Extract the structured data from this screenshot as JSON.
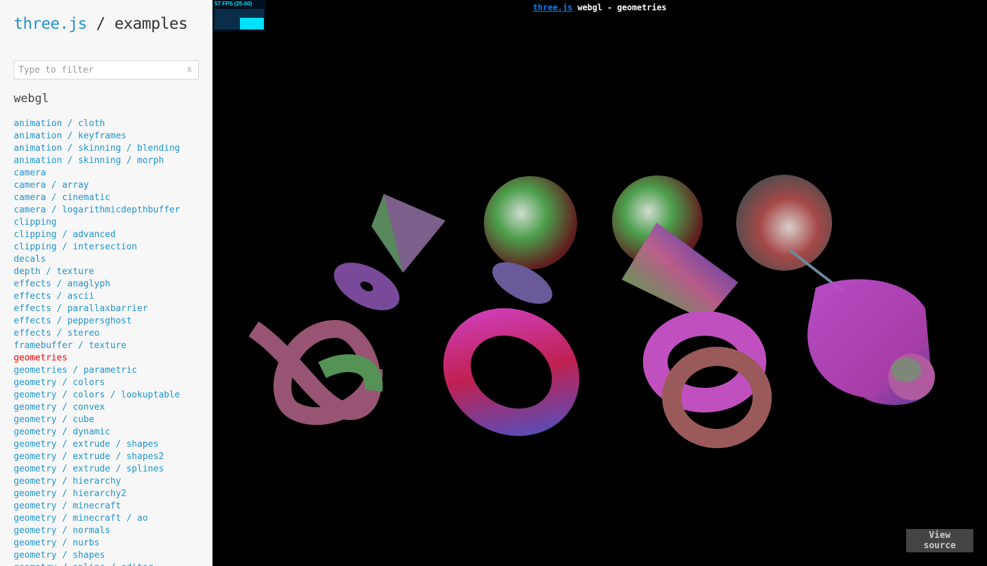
{
  "sidebar": {
    "title_link": "three.js",
    "title_sep": " / ",
    "title_rest": "examples",
    "filter_placeholder": "Type to filter",
    "filter_clear": "x",
    "section": "webgl",
    "links": [
      "animation / cloth",
      "animation / keyframes",
      "animation / skinning / blending",
      "animation / skinning / morph",
      "camera",
      "camera / array",
      "camera / cinematic",
      "camera / logarithmicdepthbuffer",
      "clipping",
      "clipping / advanced",
      "clipping / intersection",
      "decals",
      "depth / texture",
      "effects / anaglyph",
      "effects / ascii",
      "effects / parallaxbarrier",
      "effects / peppersghost",
      "effects / stereo",
      "framebuffer / texture",
      "geometries",
      "geometries / parametric",
      "geometry / colors",
      "geometry / colors / lookuptable",
      "geometry / convex",
      "geometry / cube",
      "geometry / dynamic",
      "geometry / extrude / shapes",
      "geometry / extrude / shapes2",
      "geometry / extrude / splines",
      "geometry / hierarchy",
      "geometry / hierarchy2",
      "geometry / minecraft",
      "geometry / minecraft / ao",
      "geometry / normals",
      "geometry / nurbs",
      "geometry / shapes",
      "geometry / spline / editor"
    ],
    "selected_index": 19
  },
  "viewport": {
    "info_link": "three.js",
    "info_text": " webgl - geometries",
    "stats_text": "57 FPS (25-60)",
    "view_source": "View source"
  },
  "colors": {
    "link": "#2194ce",
    "selected": "#ff0000",
    "stats_fg": "#00e0ff"
  }
}
